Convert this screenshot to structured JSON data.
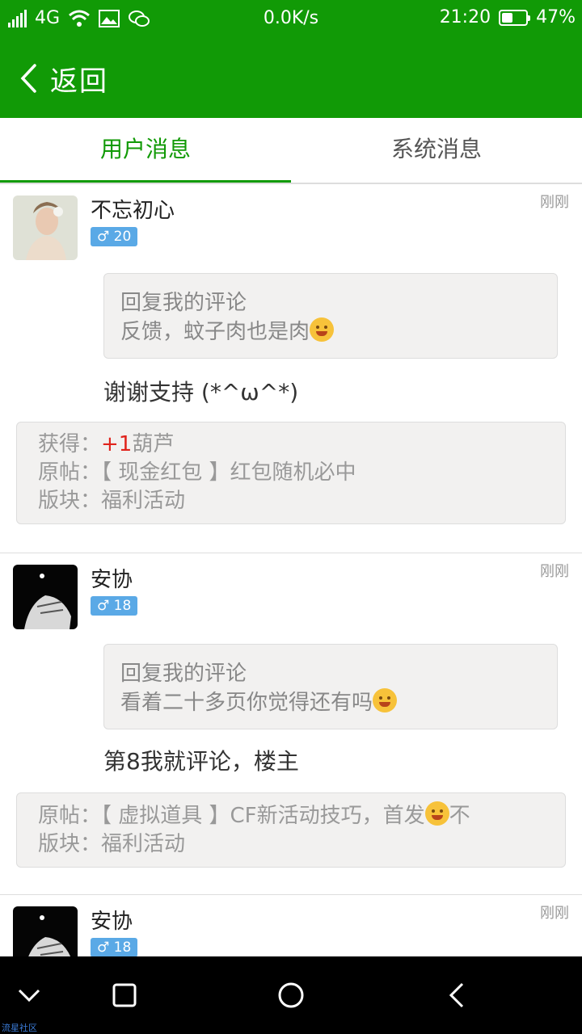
{
  "status_bar": {
    "network": "4G",
    "speed": "0.0K/s",
    "time": "21:20",
    "battery_percent": "47%",
    "battery_level": 0.47,
    "icons": [
      "signal-icon",
      "wifi-icon",
      "image-icon",
      "wechat-icon",
      "battery-icon"
    ]
  },
  "header": {
    "back_label": "返回"
  },
  "tabs": [
    {
      "label": "用户消息",
      "active": true
    },
    {
      "label": "系统消息",
      "active": false
    }
  ],
  "messages": [
    {
      "username": "不忘初心",
      "gender_age": "♂ 20",
      "time": "刚刚",
      "quote_title": "回复我的评论",
      "quote_text": "反馈，蚊子肉也是肉",
      "reply": "谢谢支持 (*^ω^*)",
      "reward_label": "获得：",
      "reward_value": "+1",
      "reward_unit": "葫芦",
      "post": "原帖：【 现金红包 】红包随机必中",
      "board": "版块：福利活动"
    },
    {
      "username": "安协",
      "gender_age": "♂ 18",
      "time": "刚刚",
      "quote_title": "回复我的评论",
      "quote_text": "看着二十多页你觉得还有吗",
      "reply": "第8我就评论，楼主",
      "post": "原帖：【 虚拟道具 】CF新活动技巧，首发",
      "post_tail": "不",
      "board": "版块：福利活动"
    },
    {
      "username": "安协",
      "gender_age": "♂ 18",
      "time": "刚刚"
    }
  ],
  "watermark": "流星社区",
  "colors": {
    "brand_green": "#119a06",
    "badge_blue": "#5aa9e6",
    "reward_red": "#e0231c"
  }
}
